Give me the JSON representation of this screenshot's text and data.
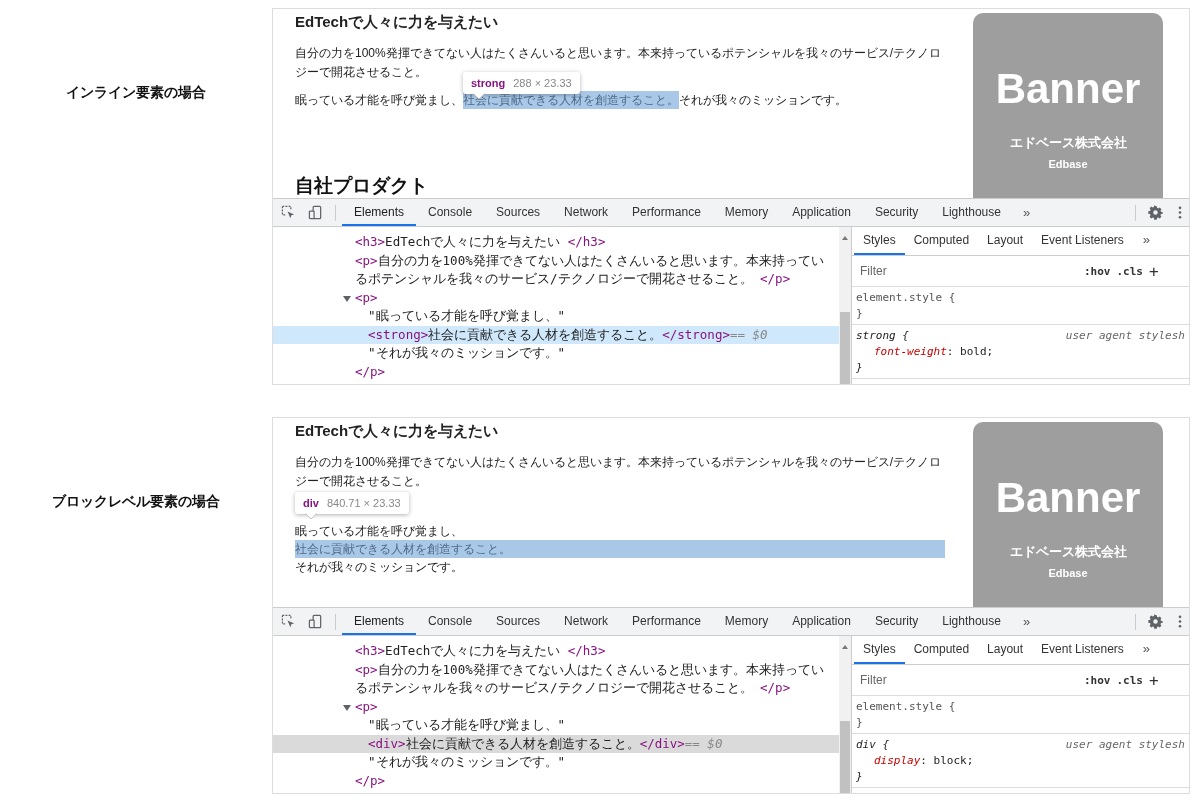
{
  "panels": [
    {
      "label": "インライン要素の場合",
      "page": {
        "heading": "EdTechで人々に力を与えたい",
        "paragraph": "自分の力を100%発揮できてない人はたくさんいると思います。本来持っているポテンシャルを我々のサービス/テクノロジーで開花させること。",
        "mission": {
          "kind": "inline",
          "before": "眠っている才能を呼び覚まし、",
          "highlighted": "社会に貢献できる人材を創造すること。",
          "after": "それが我々のミッションです。"
        },
        "tooltip": {
          "tag": "strong",
          "size": "288 × 23.33"
        },
        "next_heading": "自社プロダクト",
        "banner": {
          "title": "Banner",
          "company": "エドベース株式会社",
          "name": "Edbase"
        }
      },
      "devtools": {
        "selection_focused": true,
        "tabs": [
          {
            "label": "Elements",
            "selected": true
          },
          {
            "label": "Console",
            "selected": false
          },
          {
            "label": "Sources",
            "selected": false
          },
          {
            "label": "Network",
            "selected": false
          },
          {
            "label": "Performance",
            "selected": false
          },
          {
            "label": "Memory",
            "selected": false
          },
          {
            "label": "Application",
            "selected": false
          },
          {
            "label": "Security",
            "selected": false
          },
          {
            "label": "Lighthouse",
            "selected": false
          }
        ],
        "more": "»",
        "dom": [
          {
            "open": "<h3>",
            "text": "EdTechで人々に力を与えたい",
            "close": "</h3>",
            "selected": false
          },
          {
            "open": "<p>",
            "text": "自分の力を100%発揮できてない人はたくさんいると思います。本来持っているポテンシャルを我々のサービス/テクノロジーで開花させること。",
            "close": "</p>",
            "selected": false
          },
          {
            "open": "<p>",
            "close": "</p>",
            "expanded": true,
            "selected": false,
            "children": [
              {
                "text": "\"眠っている才能を呼び覚まし、\"",
                "selected": false
              },
              {
                "open": "<strong>",
                "text": "社会に貢献できる人材を創造すること。",
                "close": "</strong>",
                "marker": "== $0",
                "selected": true
              },
              {
                "text": "\"それが我々のミッションです。\"",
                "selected": false
              }
            ]
          }
        ],
        "style_tabs": [
          {
            "label": "Styles",
            "selected": true
          },
          {
            "label": "Computed",
            "selected": false
          },
          {
            "label": "Layout",
            "selected": false
          },
          {
            "label": "Event Listeners",
            "selected": false
          }
        ],
        "style_more": "»",
        "filter": {
          "placeholder": "Filter"
        },
        "hov": ":hov",
        "cls": ".cls",
        "plus": "+",
        "rules": [
          {
            "kind": "inline",
            "selector": "element.style",
            "open": "{",
            "close": "}"
          },
          {
            "kind": "user-agent",
            "selector": "strong",
            "open": "{",
            "close": "}",
            "source": "user agent stylesh",
            "props": [
              {
                "name": "font-weight",
                "value": ": bold;"
              }
            ]
          }
        ]
      }
    },
    {
      "label": "ブロックレベル要素の場合",
      "page": {
        "heading": "EdTechで人々に力を与えたい",
        "paragraph": "自分の力を100%発揮できてない人はたくさんいると思います。本来持っているポテンシャルを我々のサービス/テクノロジーで開花させること。",
        "mission": {
          "kind": "block",
          "before": "眠っている才能を呼び覚まし、",
          "highlighted": "社会に貢献できる人材を創造すること。",
          "after": "それが我々のミッションです。"
        },
        "tooltip": {
          "tag": "div",
          "size": "840.71 × 23.33"
        },
        "banner": {
          "title": "Banner",
          "company": "エドベース株式会社",
          "name": "Edbase"
        }
      },
      "devtools": {
        "selection_focused": false,
        "tabs": [
          {
            "label": "Elements",
            "selected": true
          },
          {
            "label": "Console",
            "selected": false
          },
          {
            "label": "Sources",
            "selected": false
          },
          {
            "label": "Network",
            "selected": false
          },
          {
            "label": "Performance",
            "selected": false
          },
          {
            "label": "Memory",
            "selected": false
          },
          {
            "label": "Application",
            "selected": false
          },
          {
            "label": "Security",
            "selected": false
          },
          {
            "label": "Lighthouse",
            "selected": false
          }
        ],
        "more": "»",
        "dom": [
          {
            "open": "<h3>",
            "text": "EdTechで人々に力を与えたい",
            "close": "</h3>",
            "selected": false
          },
          {
            "open": "<p>",
            "text": "自分の力を100%発揮できてない人はたくさんいると思います。本来持っているポテンシャルを我々のサービス/テクノロジーで開花させること。",
            "close": "</p>",
            "selected": false
          },
          {
            "open": "<p>",
            "close": "</p>",
            "expanded": true,
            "selected": false,
            "children": [
              {
                "text": "\"眠っている才能を呼び覚まし、\"",
                "selected": false
              },
              {
                "open": "<div>",
                "text": "社会に貢献できる人材を創造すること。",
                "close": "</div>",
                "marker": "== $0",
                "selected": true
              },
              {
                "text": "\"それが我々のミッションです。\"",
                "selected": false
              }
            ]
          }
        ],
        "style_tabs": [
          {
            "label": "Styles",
            "selected": true
          },
          {
            "label": "Computed",
            "selected": false
          },
          {
            "label": "Layout",
            "selected": false
          },
          {
            "label": "Event Listeners",
            "selected": false
          }
        ],
        "style_more": "»",
        "filter": {
          "placeholder": "Filter"
        },
        "hov": ":hov",
        "cls": ".cls",
        "plus": "+",
        "rules": [
          {
            "kind": "inline",
            "selector": "element.style",
            "open": "{",
            "close": "}"
          },
          {
            "kind": "user-agent",
            "selector": "div",
            "open": "{",
            "close": "}",
            "source": "user agent stylesh",
            "props": [
              {
                "name": "display",
                "value": ": block;"
              }
            ]
          }
        ]
      }
    }
  ]
}
